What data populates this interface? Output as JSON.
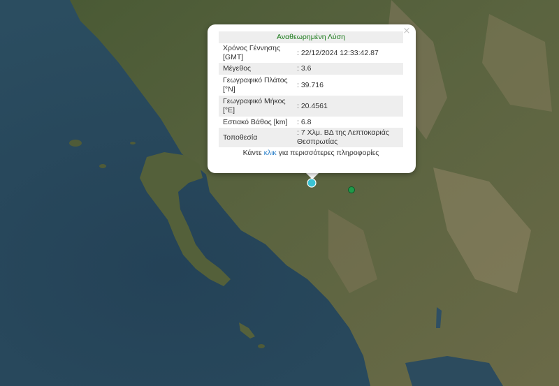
{
  "popup": {
    "title": "Αναθεωρημένη Λύση",
    "close_label": "×",
    "rows": [
      {
        "label": "Χρόνος Γέννησης [GMT]",
        "value": ": 22/12/2024 12:33:42.87"
      },
      {
        "label": "Μέγεθος",
        "value": ": 3.6"
      },
      {
        "label": "Γεωγραφικό Πλάτος [°N]",
        "value": ": 39.716"
      },
      {
        "label": "Γεωγραφικό Μήκος [°E]",
        "value": ": 20.4561"
      },
      {
        "label": "Εστιακό Βάθος [km]",
        "value": ": 6.8"
      },
      {
        "label": "Τοποθεσία",
        "value": ": 7 Χλμ. ΒΔ της Λεπτοκαριάς Θεσπρωτίας"
      }
    ],
    "footer_pre": "Κάντε ",
    "footer_link": "κλικ",
    "footer_post": " για περισσότερες πληροφορίες"
  },
  "markers": [
    {
      "name": "selected-earthquake",
      "color": "#3ac3d3"
    },
    {
      "name": "earthquake",
      "color": "#1f9a4a"
    }
  ],
  "colors": {
    "sea": "#27465a",
    "land": "#4c5d37",
    "mountain": "#8b7f64",
    "title_green": "#1a7a1a",
    "link_blue": "#2a7fc9"
  }
}
